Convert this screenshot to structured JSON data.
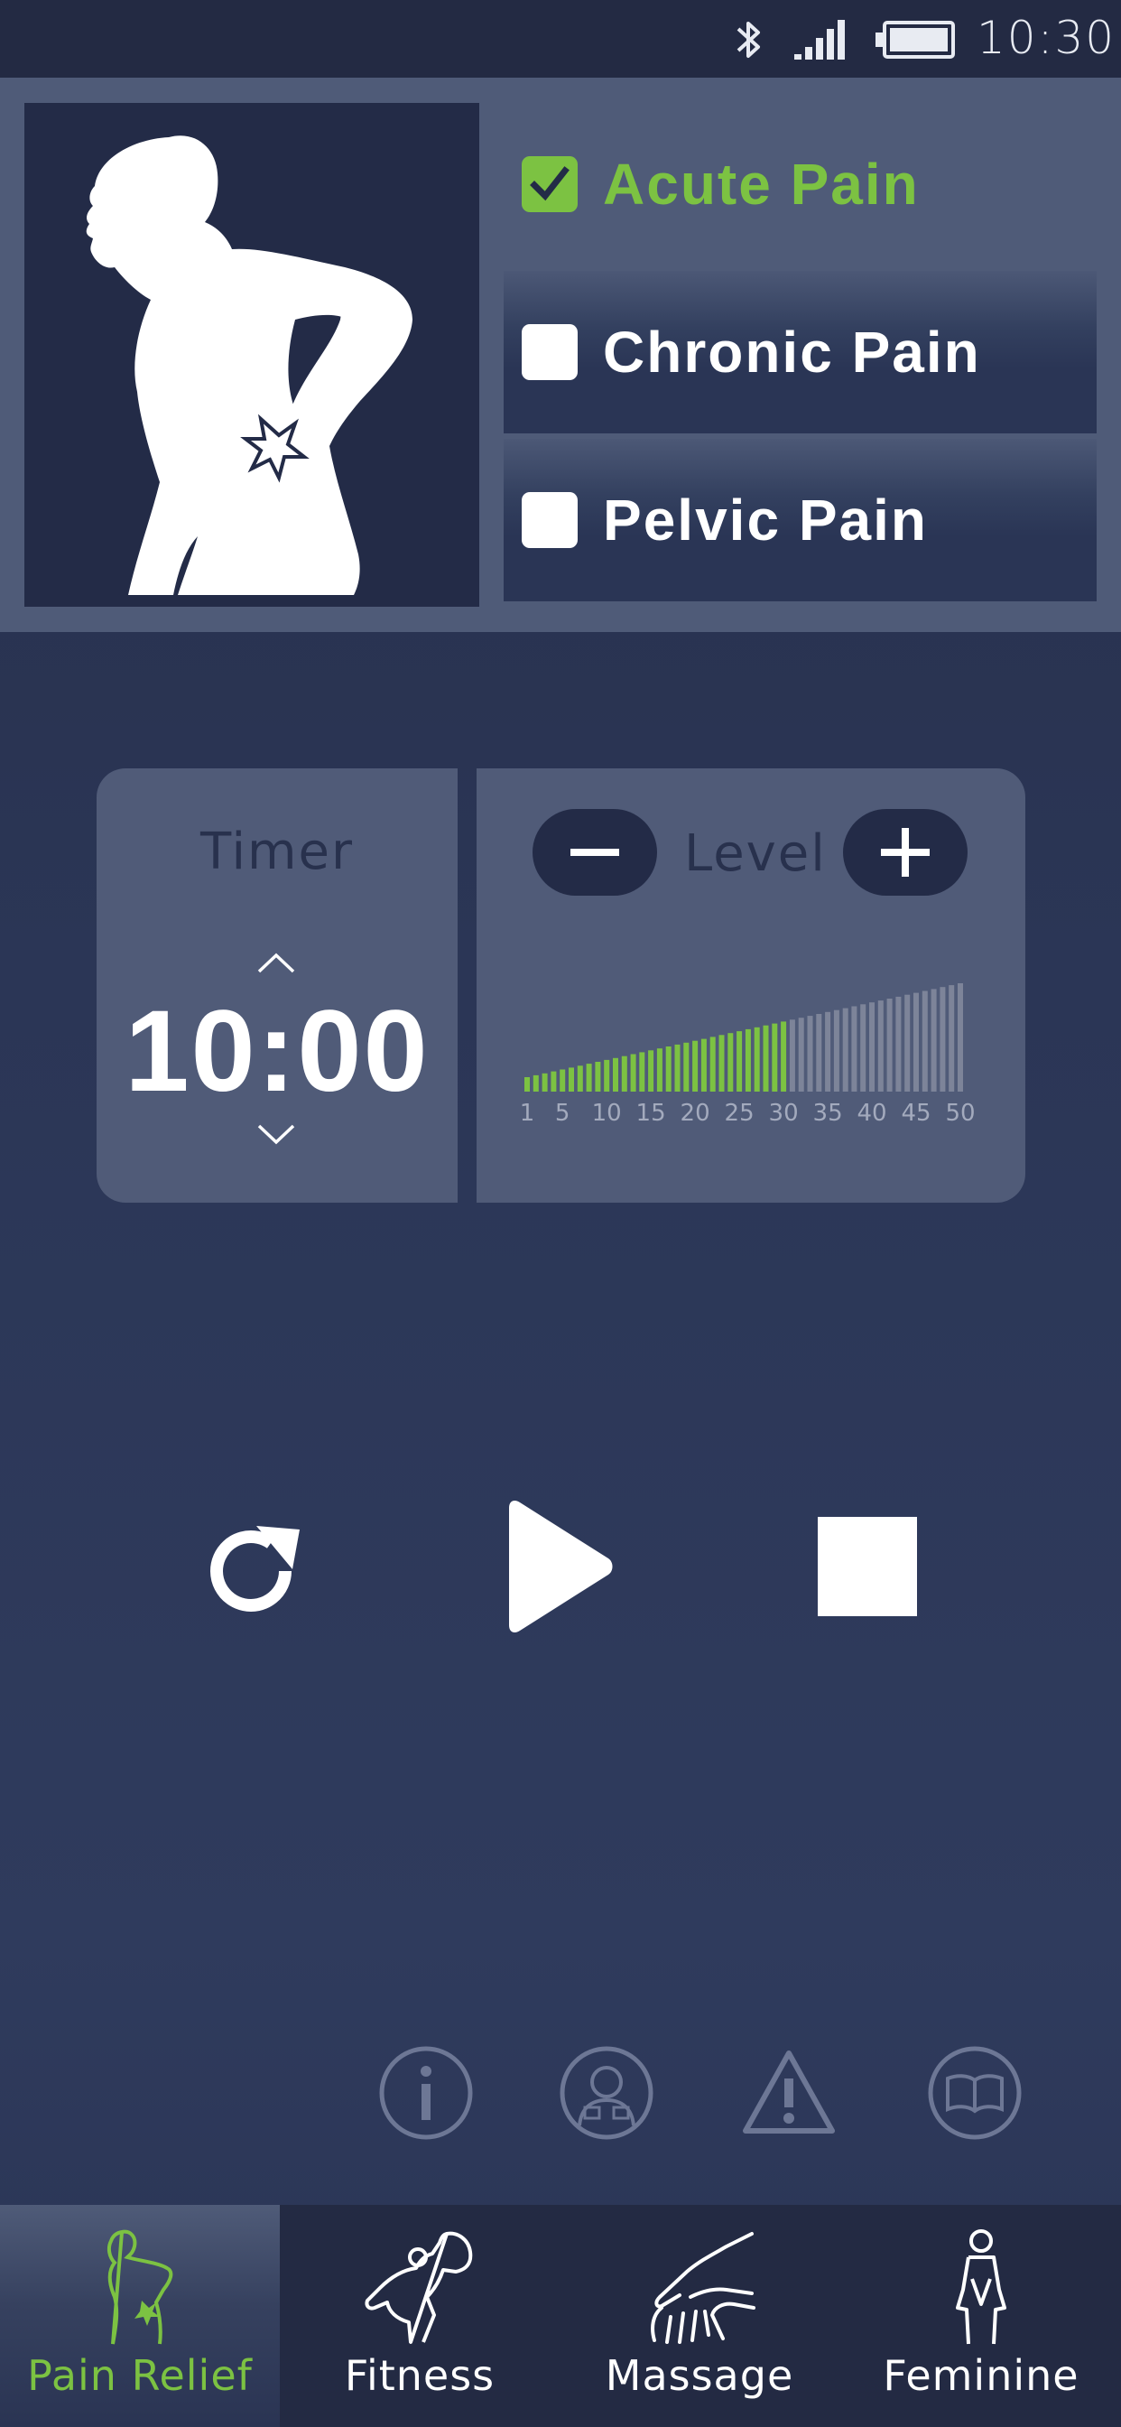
{
  "status_bar": {
    "time": "10:30",
    "icons": [
      "bluetooth-icon",
      "signal-icon",
      "battery-icon"
    ]
  },
  "conditions": {
    "figure": "back-pain-figure",
    "options": [
      {
        "label": "Acute Pain",
        "checked": true
      },
      {
        "label": "Chronic Pain",
        "checked": false
      },
      {
        "label": "Pelvic Pain",
        "checked": false
      }
    ]
  },
  "timer": {
    "title": "Timer",
    "value": "10:00"
  },
  "level": {
    "title": "Level",
    "current": 30,
    "max": 50,
    "tick_labels": [
      "1",
      "5",
      "10",
      "15",
      "20",
      "25",
      "30",
      "35",
      "40",
      "45",
      "50"
    ]
  },
  "controls": [
    "reset-icon",
    "play-icon",
    "stop-icon"
  ],
  "info_icons": [
    "info-icon",
    "electrode-placement-icon",
    "warning-icon",
    "manual-book-icon"
  ],
  "tabs": [
    {
      "label": "Pain Relief",
      "active": true
    },
    {
      "label": "Fitness",
      "active": false
    },
    {
      "label": "Massage",
      "active": false
    },
    {
      "label": "Feminine",
      "active": false
    }
  ],
  "colors": {
    "accent_green": "#7cc242",
    "panel": "#505b78",
    "dark_navy": "#232b47",
    "inactive_bar": "#7d8499"
  }
}
